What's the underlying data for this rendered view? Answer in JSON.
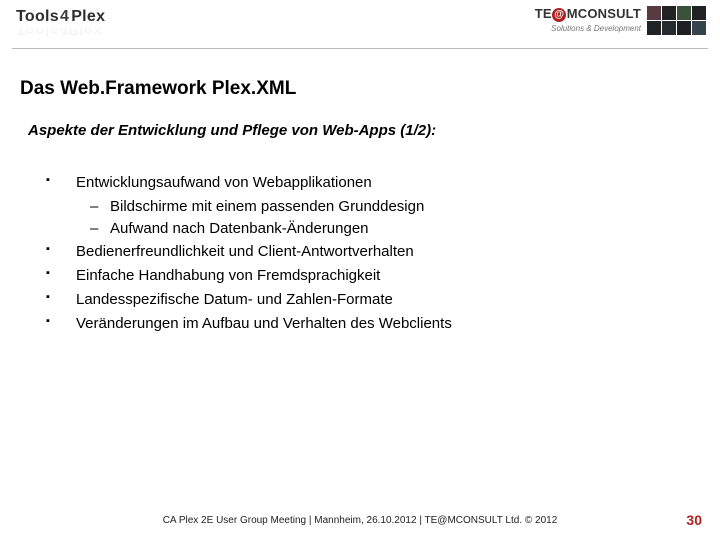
{
  "header": {
    "logo_left": {
      "tools": "Tools",
      "four": "4",
      "plex": "Plex"
    },
    "logo_right": {
      "pre": "TE",
      "at": "@",
      "post": "MCONSULT",
      "sub": "Solutions & Development"
    }
  },
  "title": "Das Web.Framework Plex.XML",
  "subtitle": "Aspekte der Entwicklung und Pflege von Web-Apps (1/2):",
  "bullets": [
    {
      "text": "Entwicklungsaufwand von Webapplikationen",
      "sub": [
        "Bildschirme mit einem passenden Grunddesign",
        "Aufwand nach Datenbank-Änderungen"
      ]
    },
    {
      "text": "Bedienerfreundlichkeit und Client-Antwortverhalten"
    },
    {
      "text": "Einfache Handhabung von Fremdsprachigkeit"
    },
    {
      "text": "Landesspezifische Datum- und Zahlen-Formate"
    },
    {
      "text": "Veränderungen im Aufbau und Verhalten des Webclients"
    }
  ],
  "footer": "CA Plex 2E User Group Meeting | Mannheim, 26.10.2012 | TE@MCONSULT Ltd. © 2012",
  "page_number": "30"
}
